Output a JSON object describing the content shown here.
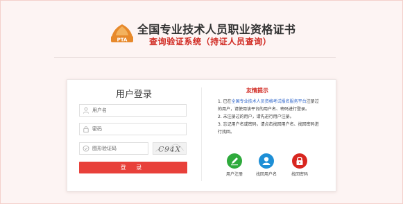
{
  "header": {
    "logo_text": "PTA",
    "title": "全国专业技术人员职业资格证书",
    "subtitle": "查询验证系统（持证人员查询）"
  },
  "login": {
    "title": "用户登录",
    "username_placeholder": "用户名",
    "password_placeholder": "密码",
    "captcha_placeholder": "图形验证码",
    "captcha_text": "C94X",
    "submit_label": "登 录"
  },
  "tips": {
    "title": "友情提示",
    "line1_prefix": "1. 已在",
    "line1_link": "全国专业技术人员资格考试报名服务平台",
    "line1_suffix": "注册过的用户，请使用该平台的用户名、密码进行登录。",
    "line2": "2. 未注册过的用户，请先进行用户注册。",
    "line3": "3. 忘记用户名或密码，请点击找回用户名、找回密码进行找回。"
  },
  "actions": [
    {
      "label": "用户注册",
      "icon": "pencil-icon",
      "color": "#2eaa3c"
    },
    {
      "label": "找回用户名",
      "icon": "user-icon",
      "color": "#1e8fd6"
    },
    {
      "label": "找回密码",
      "icon": "lock-icon",
      "color": "#d8261f"
    }
  ],
  "colors": {
    "accent_red": "#d0271f",
    "button_red": "#e8403a",
    "link_blue": "#2c63c9",
    "background": "#fdf4f3"
  }
}
